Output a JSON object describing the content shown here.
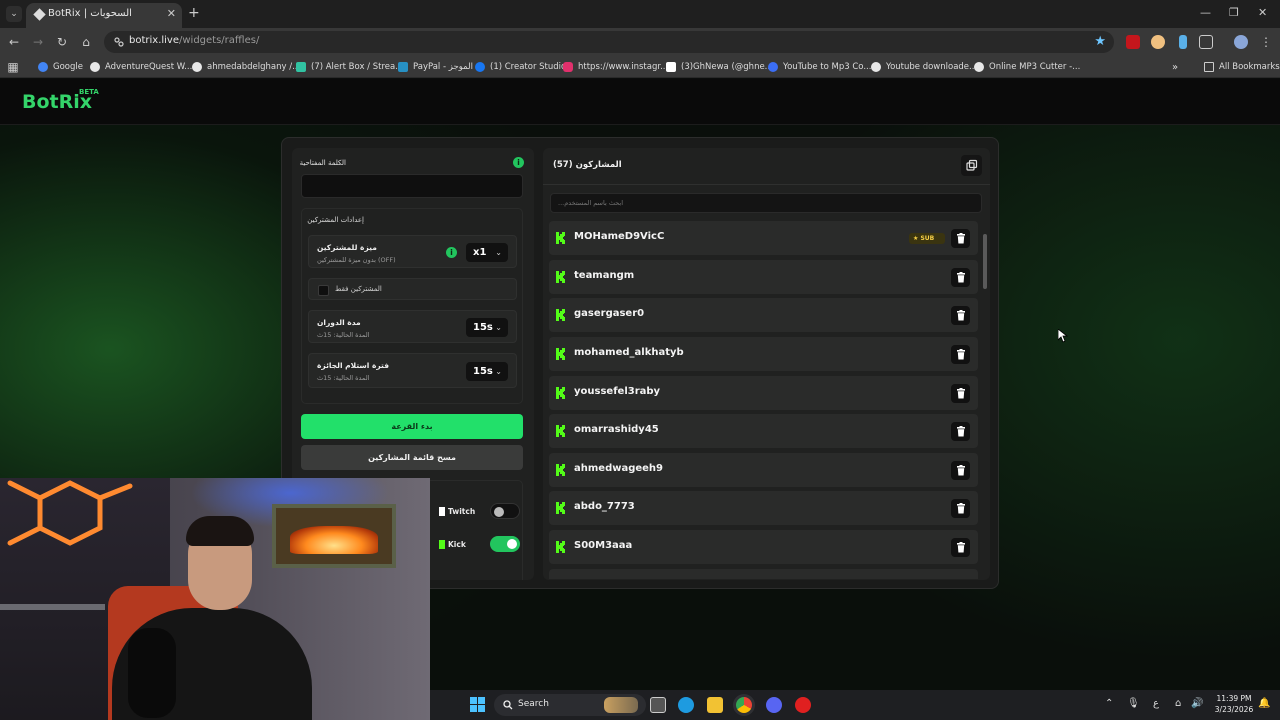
{
  "browser": {
    "tab_title": "BotRix | السحوبات",
    "url_domain": "botrix.live",
    "url_path": "/widgets/raffles/",
    "bookmarks": [
      {
        "label": "Google",
        "color": "#4285f4"
      },
      {
        "label": "AdventureQuest W...",
        "color": "#e8e8e8"
      },
      {
        "label": "ahmedabdelghany /...",
        "color": "#e8e8e8"
      },
      {
        "label": "(7) Alert Box / Strea...",
        "color": "#31c3a2"
      },
      {
        "label": "PayPal - الموجز",
        "color": "#2790c3"
      },
      {
        "label": "(1) Creator Studio",
        "color": "#1877f2"
      },
      {
        "label": "https://www.instagr...",
        "color": "#e1306c"
      },
      {
        "label": "(3)GhNewa (@ghne...",
        "color": "#ffffff"
      },
      {
        "label": "YouTube to Mp3 Co...",
        "color": "#3b6ef5"
      },
      {
        "label": "Youtube downloade...",
        "color": "#e8e8e8"
      },
      {
        "label": "Online MP3 Cutter -...",
        "color": "#e8e8e8"
      }
    ],
    "all_bookmarks_label": "All Bookmarks"
  },
  "site": {
    "logo": "BotRix",
    "logo_badge": "BETA"
  },
  "settings": {
    "keyword_label": "الكلمة المفتاحية",
    "keyword_value": "",
    "subscriber_settings_title": "إعدادات المشتركين",
    "sub_bonus_title": "ميزة للمشتركين",
    "sub_bonus_sub": "بدون ميزة للمشتركين (OFF)",
    "sub_bonus_value": "x1",
    "subs_only_label": "المشتركين فقط",
    "spin_title": "مدة الدوران",
    "spin_sub": "المدة الحالية: 15ث",
    "spin_value": "15s",
    "claim_title": "فترة استلام الجائزة",
    "claim_sub": "المدة الحالية: 15ث",
    "claim_value": "15s",
    "start_button": "بدء القرعة",
    "clear_button": "مسح قائمة المشاركين",
    "platforms": [
      {
        "label": "Twitch",
        "enabled": false
      },
      {
        "label": "Kick",
        "enabled": true
      }
    ]
  },
  "participants": {
    "title": "المشاركون (57)",
    "search_placeholder": "ابحث باسم المستخدم...",
    "sub_badge": "SUB",
    "list": [
      {
        "name": "MOHameD9VicC",
        "sub": true
      },
      {
        "name": "teamangm",
        "sub": false
      },
      {
        "name": "gasergaser0",
        "sub": false
      },
      {
        "name": "mohamed_alkhatyb",
        "sub": false
      },
      {
        "name": "youssefel3raby",
        "sub": false
      },
      {
        "name": "omarrashidy45",
        "sub": false
      },
      {
        "name": "ahmedwageeh9",
        "sub": false
      },
      {
        "name": "abdo_7773",
        "sub": false
      },
      {
        "name": "S00M3aaa",
        "sub": false
      }
    ]
  },
  "taskbar": {
    "search_label": "Search",
    "lang": "ع",
    "time": "11:39 PM",
    "date": "3/23/2026"
  },
  "colors": {
    "accent_green": "#22e06a",
    "kick_green": "#53fc18",
    "sub_gold": "#f7d046"
  }
}
